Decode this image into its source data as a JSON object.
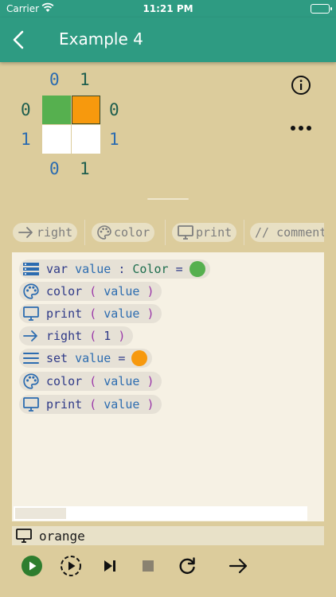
{
  "status_bar": {
    "carrier": "Carrier",
    "time": "11:21 PM",
    "battery_level": 1.0
  },
  "nav": {
    "title": "Example 4",
    "back_icon": "chevron-left-icon"
  },
  "grid": {
    "top_labels": [
      "0",
      "1"
    ],
    "bottom_labels": [
      "0",
      "1"
    ],
    "left_labels": [
      "0",
      "1"
    ],
    "right_labels": [
      "0",
      "1"
    ],
    "cells": [
      [
        "#56b04f",
        "#f7990d"
      ],
      [
        "#ffffff",
        "#ffffff"
      ]
    ],
    "selected_cell": [
      0,
      1
    ]
  },
  "toolbar_icons": [
    "info-icon",
    "more-icon"
  ],
  "palette": [
    {
      "label": "right",
      "icon": "arrow-right-icon"
    },
    {
      "label": "color",
      "icon": "palette-icon"
    },
    {
      "label": "print",
      "icon": "monitor-icon"
    },
    {
      "label": "// comment",
      "icon": ""
    }
  ],
  "code": {
    "lines": [
      {
        "icon": "variable-icon",
        "keyword": "var",
        "name": "value",
        "colon": ":",
        "type": "Color",
        "op": "=",
        "color": "#56b04f"
      },
      {
        "icon": "palette-icon",
        "keyword": "color",
        "open": "(",
        "arg": "value",
        "close": ")"
      },
      {
        "icon": "monitor-icon",
        "keyword": "print",
        "open": "(",
        "arg": "value",
        "close": ")"
      },
      {
        "icon": "arrow-right-icon",
        "keyword": "right",
        "open": "(",
        "arg": "1",
        "close": ")"
      },
      {
        "icon": "set-icon",
        "keyword": "set",
        "name": "value",
        "op": "=",
        "color": "#f7990d"
      },
      {
        "icon": "palette-icon",
        "keyword": "color",
        "open": "(",
        "arg": "value",
        "close": ")"
      },
      {
        "icon": "monitor-icon",
        "keyword": "print",
        "open": "(",
        "arg": "value",
        "close": ")"
      }
    ]
  },
  "console": {
    "output": "orange",
    "icon": "monitor-icon"
  },
  "controls": [
    {
      "name": "run-button",
      "icon": "play-icon"
    },
    {
      "name": "step-run-button",
      "icon": "step-play-icon"
    },
    {
      "name": "step-button",
      "icon": "skip-next-icon"
    },
    {
      "name": "stop-button",
      "icon": "stop-icon"
    },
    {
      "name": "reset-button",
      "icon": "refresh-icon"
    },
    {
      "name": "next-button",
      "icon": "arrow-right-icon"
    }
  ],
  "colors": {
    "header": "#2e9b82",
    "background": "#dccc9c",
    "green": "#56b04f",
    "orange": "#f7990d"
  }
}
